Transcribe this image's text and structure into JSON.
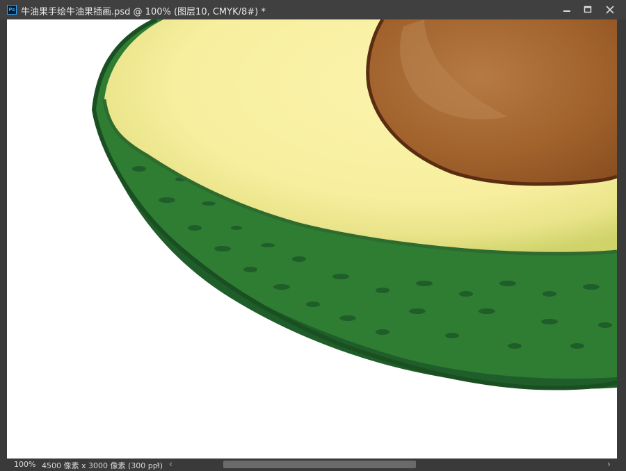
{
  "titlebar": {
    "app_icon": "photoshop-icon",
    "app_icon_text": "Ps",
    "document_title": "牛油果手绘牛油果插画.psd @ 100% (图层10, CMYK/8#) *",
    "minimize_icon": "minimize-icon",
    "maximize_icon": "maximize-icon",
    "close_icon": "close-icon"
  },
  "canvas": {
    "artwork": "avocado-illustration",
    "colors": {
      "skin_dark": "#1f5e2a",
      "skin_mid": "#2e7d32",
      "flesh": "#f7eea0",
      "flesh_rim": "#d6d77a",
      "pit": "#a5652e",
      "pit_outline": "#5a2d12"
    }
  },
  "statusbar": {
    "zoom": "100%",
    "document_info": "4500 像素 x 3000 像素 (300 ppi)",
    "info_arrow": "›",
    "scroll_left": "‹",
    "scroll_right": "›"
  },
  "theme": {
    "window_bg": "#404040",
    "accent": "#31a8ff"
  }
}
